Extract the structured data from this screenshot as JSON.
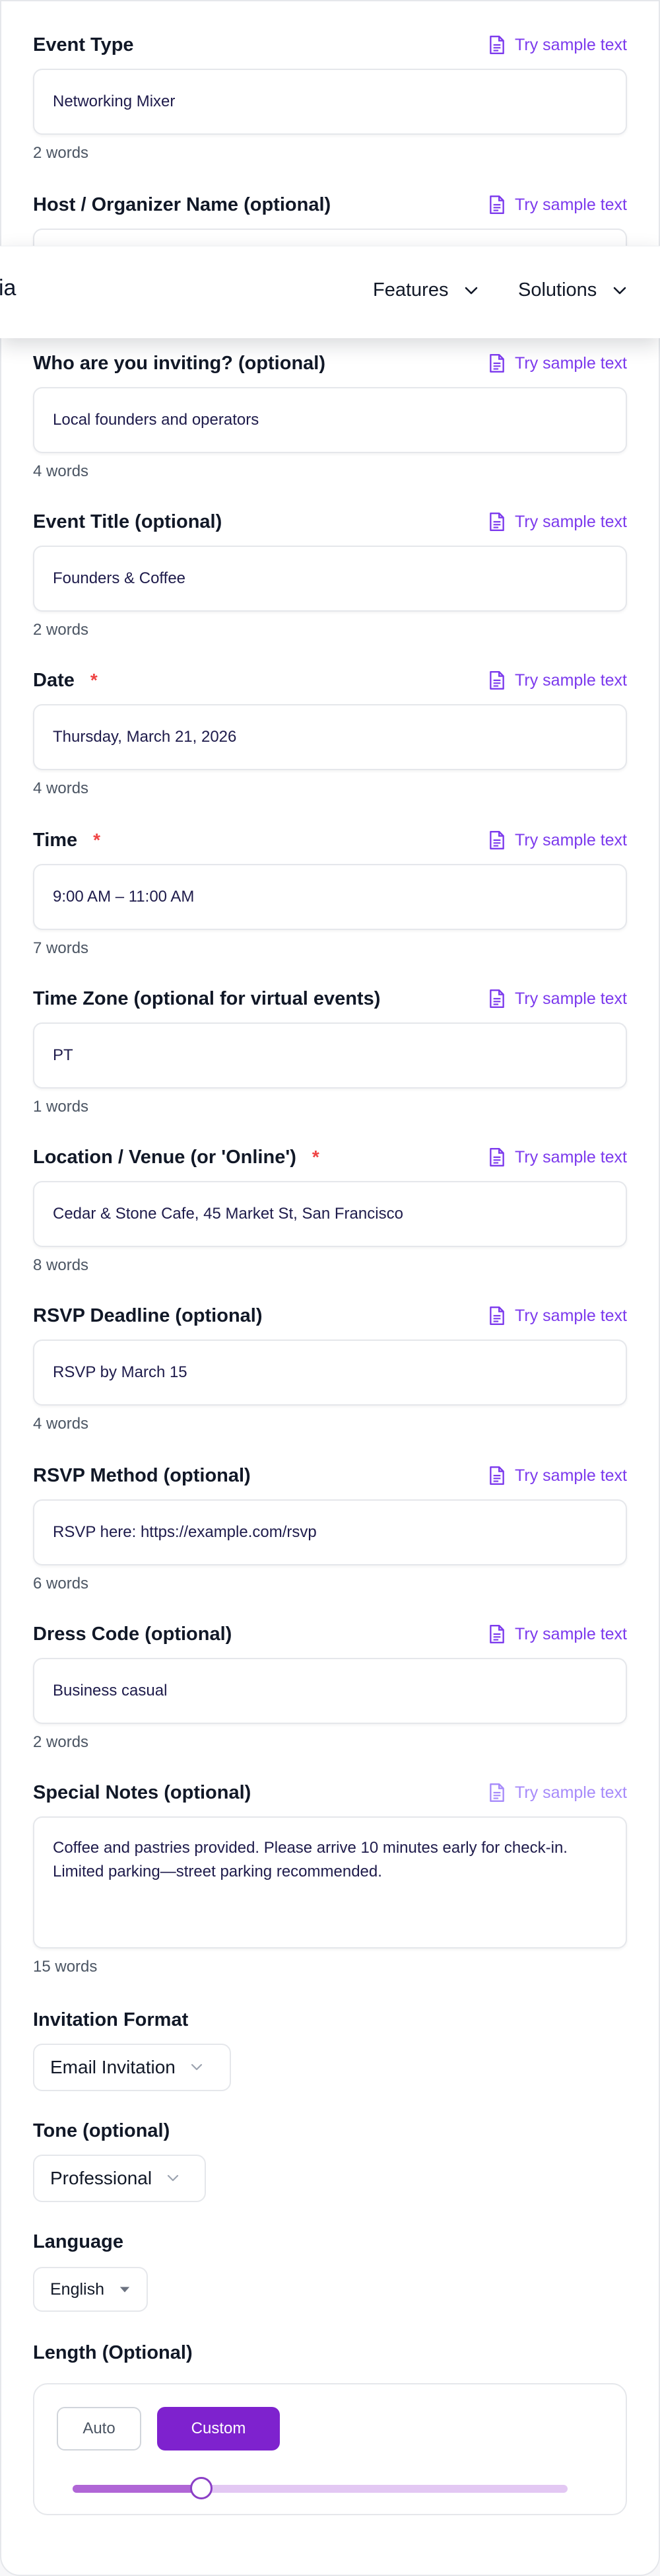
{
  "sample_link": "Try sample text",
  "fields": {
    "event_type": {
      "label": "Event Type",
      "value": "Networking Mixer",
      "count": "2 words"
    },
    "host": {
      "label": "Host / Organizer Name (optional)"
    },
    "invitees": {
      "label": "Who are you inviting? (optional)",
      "value": "Local founders and operators",
      "count": "4 words"
    },
    "title": {
      "label": "Event Title (optional)",
      "value": "Founders & Coffee",
      "count": "2 words"
    },
    "date": {
      "label": "Date",
      "required": "*",
      "value": "Thursday, March 21, 2026",
      "count": "4 words"
    },
    "time": {
      "label": "Time",
      "required": "*",
      "value": "9:00 AM – 11:00 AM",
      "count": "7 words"
    },
    "timezone": {
      "label": "Time Zone (optional for virtual events)",
      "value": "PT",
      "count": "1 words"
    },
    "location": {
      "label": "Location / Venue (or 'Online')",
      "required": "*",
      "value": "Cedar & Stone Cafe, 45 Market St, San Francisco",
      "count": "8 words"
    },
    "rsvp_deadline": {
      "label": "RSVP Deadline (optional)",
      "value": "RSVP by March 15",
      "count": "4 words"
    },
    "rsvp_method": {
      "label": "RSVP Method (optional)",
      "value": "RSVP here: https://example.com/rsvp",
      "count": "6 words"
    },
    "dress_code": {
      "label": "Dress Code (optional)",
      "value": "Business casual",
      "count": "2 words"
    },
    "notes": {
      "label": "Special Notes (optional)",
      "value": "Coffee and pastries provided. Please arrive 10 minutes early for check-in. Limited parking—street parking recommended.",
      "count": "15 words"
    }
  },
  "nav": {
    "logo_fragment": "ia",
    "features": "Features",
    "solutions": "Solutions"
  },
  "invitation_format": {
    "label": "Invitation Format",
    "selected": "Email Invitation"
  },
  "tone": {
    "label": "Tone (optional)",
    "selected": "Professional"
  },
  "language": {
    "label": "Language",
    "selected": "English"
  },
  "length": {
    "label": "Length (Optional)",
    "auto": "Auto",
    "custom": "Custom",
    "selected": "Custom",
    "slider_fraction": 0.26
  },
  "colors": {
    "accent": "#7c3aed",
    "required": "#ef4444",
    "custom_button": "#7e22ce"
  }
}
